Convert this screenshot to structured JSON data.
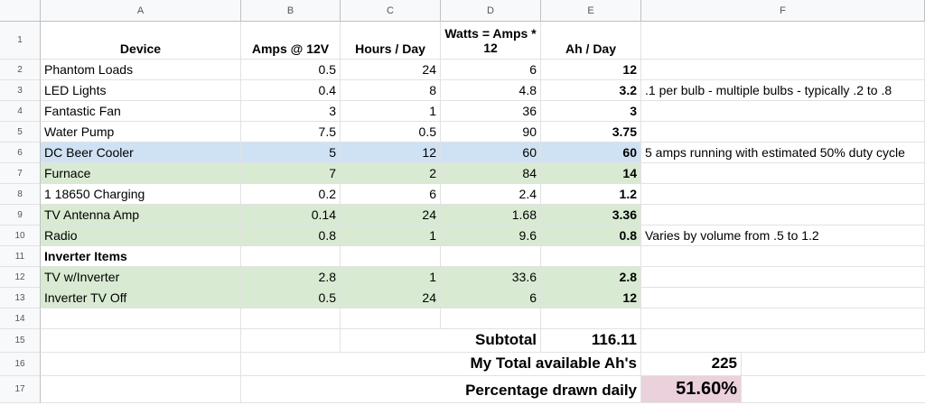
{
  "columns": [
    "A",
    "B",
    "C",
    "D",
    "E",
    "F"
  ],
  "header": {
    "device": "Device",
    "amps": "Amps @ 12V",
    "hours": "Hours / Day",
    "watts": "Watts = Amps * 12",
    "ah": "Ah / Day"
  },
  "rows": [
    {
      "n": "2",
      "device": "Phantom Loads",
      "amps": "0.5",
      "hours": "24",
      "watts": "6",
      "ah": "12",
      "note": ""
    },
    {
      "n": "3",
      "device": "LED Lights",
      "amps": "0.4",
      "hours": "8",
      "watts": "4.8",
      "ah": "3.2",
      "note": ".1 per bulb - multiple bulbs - typically .2 to .8"
    },
    {
      "n": "4",
      "device": "Fantastic Fan",
      "amps": "3",
      "hours": "1",
      "watts": "36",
      "ah": "3",
      "note": ""
    },
    {
      "n": "5",
      "device": "Water Pump",
      "amps": "7.5",
      "hours": "0.5",
      "watts": "90",
      "ah": "3.75",
      "note": ""
    },
    {
      "n": "6",
      "device": "DC Beer Cooler",
      "amps": "5",
      "hours": "12",
      "watts": "60",
      "ah": "60",
      "note": "5 amps running with estimated 50% duty cycle"
    },
    {
      "n": "7",
      "device": "Furnace",
      "amps": "7",
      "hours": "2",
      "watts": "84",
      "ah": "14",
      "note": ""
    },
    {
      "n": "8",
      "device": "1 18650 Charging",
      "amps": "0.2",
      "hours": "6",
      "watts": "2.4",
      "ah": "1.2",
      "note": ""
    },
    {
      "n": "9",
      "device": "TV Antenna Amp",
      "amps": "0.14",
      "hours": "24",
      "watts": "1.68",
      "ah": "3.36",
      "note": ""
    },
    {
      "n": "10",
      "device": "Radio",
      "amps": "0.8",
      "hours": "1",
      "watts": "9.6",
      "ah": "0.8",
      "note": "Varies by volume from .5 to 1.2"
    },
    {
      "n": "11",
      "device": "Inverter Items",
      "amps": "",
      "hours": "",
      "watts": "",
      "ah": "",
      "note": ""
    },
    {
      "n": "12",
      "device": "TV w/Inverter",
      "amps": "2.8",
      "hours": "1",
      "watts": "33.6",
      "ah": "2.8",
      "note": ""
    },
    {
      "n": "13",
      "device": "Inverter TV Off",
      "amps": "0.5",
      "hours": "24",
      "watts": "6",
      "ah": "12",
      "note": ""
    }
  ],
  "summary": {
    "row14": "14",
    "row15": "15",
    "subtotal_label": "Subtotal",
    "subtotal_value": "116.11",
    "row16": "16",
    "total_label": "My Total available Ah's",
    "total_value": "225",
    "row17": "17",
    "pct_label": "Percentage drawn daily",
    "pct_value": "51.60%"
  },
  "row_one": "1",
  "colors": {
    "blue": "#cfe2f3",
    "green": "#d9ead3",
    "pink": "#ead1dc"
  }
}
